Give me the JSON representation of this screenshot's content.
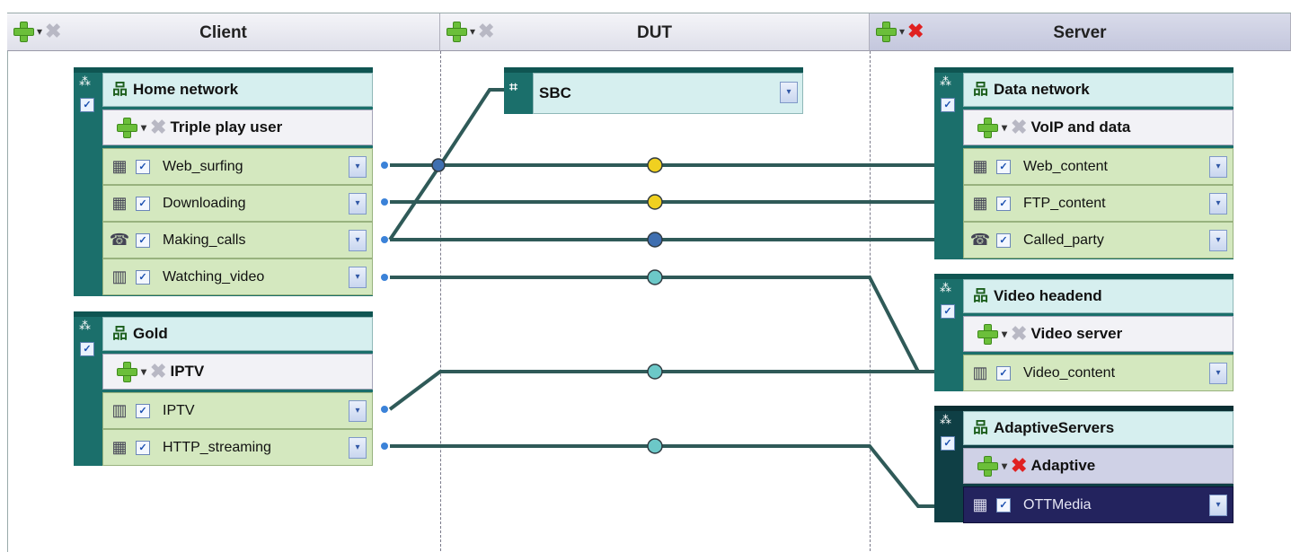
{
  "columns": {
    "client": {
      "title": "Client"
    },
    "dut": {
      "title": "DUT"
    },
    "server": {
      "title": "Server"
    }
  },
  "toolbar": {
    "add_icon": "plus-icon",
    "dropdown_icon": "caret-down-icon",
    "remove_icon": "x-icon"
  },
  "dut": {
    "sbc": {
      "label": "SBC"
    }
  },
  "client_groups": [
    {
      "title": "Home network",
      "subgroup": "Triple play user",
      "rows": [
        {
          "label": "Web_surfing",
          "icon": "data-app-icon"
        },
        {
          "label": "Downloading",
          "icon": "data-app-icon"
        },
        {
          "label": "Making_calls",
          "icon": "voice-app-icon"
        },
        {
          "label": "Watching_video",
          "icon": "video-app-icon"
        }
      ]
    },
    {
      "title": "Gold",
      "subgroup": "IPTV",
      "rows": [
        {
          "label": "IPTV",
          "icon": "video-app-icon"
        },
        {
          "label": "HTTP_streaming",
          "icon": "data-app-icon"
        }
      ]
    }
  ],
  "server_groups": [
    {
      "title": "Data network",
      "subgroup": "VoIP and data",
      "rows": [
        {
          "label": "Web_content",
          "icon": "data-app-icon"
        },
        {
          "label": "FTP_content",
          "icon": "data-app-icon"
        },
        {
          "label": "Called_party",
          "icon": "voice-app-icon"
        }
      ]
    },
    {
      "title": "Video headend",
      "subgroup": "Video server",
      "rows": [
        {
          "label": "Video_content",
          "icon": "video-app-icon"
        }
      ]
    },
    {
      "title": "AdaptiveServers",
      "subgroup": "Adaptive",
      "rows": [
        {
          "label": "OTTMedia",
          "icon": "data-app-icon"
        }
      ]
    }
  ],
  "colors": {
    "accent_teal": "#1b6f6b",
    "row_green": "#d4e8bf",
    "selected_row": "#23235e",
    "dot_yellow": "#f0d020",
    "dot_blue": "#3f6fb0",
    "dot_cyan": "#6cc8c8"
  }
}
